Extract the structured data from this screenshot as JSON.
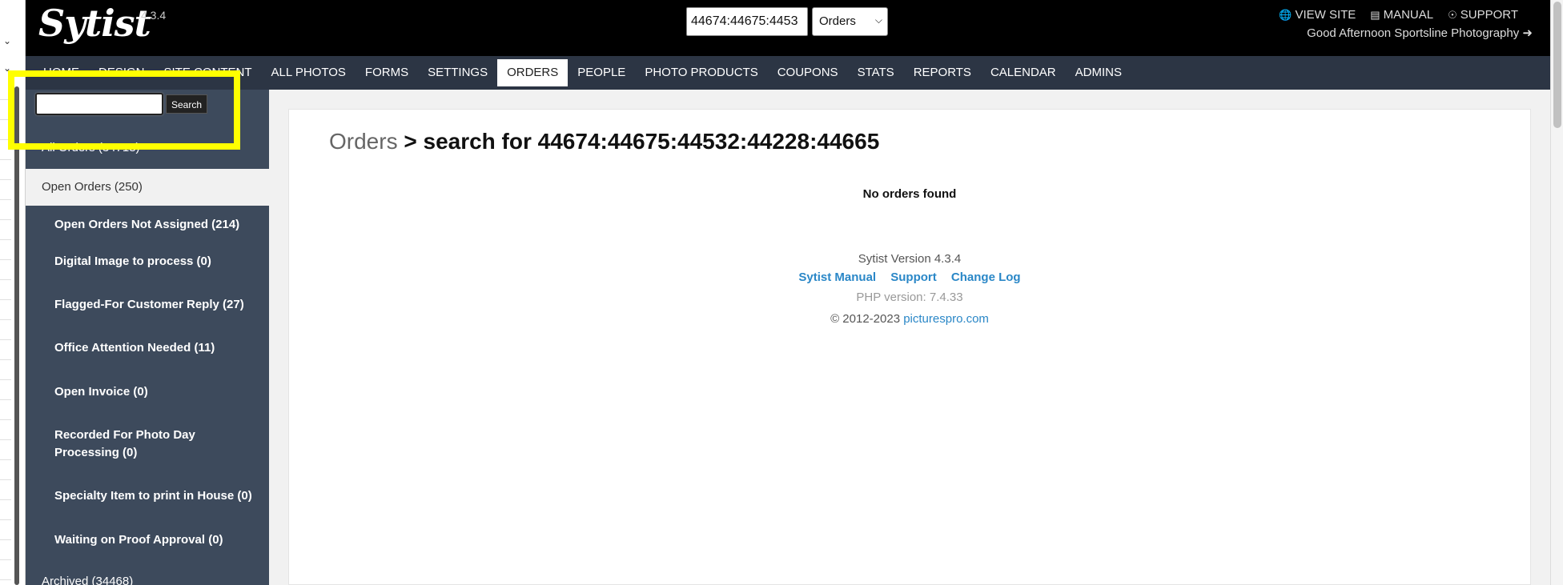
{
  "header": {
    "logo": "Sytist",
    "version": "4.3.4",
    "search_value": "44674:44675:4453",
    "select_value": "Orders",
    "links": {
      "view_site": "VIEW SITE",
      "manual": "MANUAL",
      "support": "SUPPORT"
    },
    "greeting": "Good Afternoon Sportsline Photography"
  },
  "nav": {
    "items": [
      "HOME",
      "DESIGN",
      "SITE CONTENT",
      "ALL PHOTOS",
      "FORMS",
      "SETTINGS",
      "ORDERS",
      "PEOPLE",
      "PHOTO PRODUCTS",
      "COUPONS",
      "STATS",
      "REPORTS",
      "CALENDAR",
      "ADMINS"
    ],
    "active": "ORDERS"
  },
  "sidebar": {
    "search_button": "Search",
    "all_orders": "All Orders (34718)",
    "open_orders": "Open Orders (250)",
    "sub_items": [
      "Open Orders Not Assigned (214)",
      "Digital Image to process (0)",
      "Flagged-For Customer Reply (27)",
      "Office Attention Needed (11)",
      "Open Invoice (0)",
      "Recorded For Photo Day Processing (0)",
      "Specialty Item to print in House (0)",
      "Waiting on Proof Approval (0)"
    ],
    "archived": "Archived (34468)"
  },
  "main": {
    "title_prefix": "Orders",
    "title_query": "> search for 44674:44675:44532:44228:44665",
    "no_orders": "No orders found",
    "footer": {
      "version": "Sytist Version 4.3.4",
      "link_manual": "Sytist Manual",
      "link_support": "Support",
      "link_changelog": "Change Log",
      "php": "PHP version: 7.4.33",
      "copyright": "© 2012-2023",
      "copyright_link": "picturespro.com"
    }
  },
  "colors": {
    "header_bg": "#000000",
    "nav_bg": "#2c3544",
    "sidebar_bg": "#3d4a5c",
    "link": "#2a87c7",
    "highlight": "#ffff00"
  }
}
